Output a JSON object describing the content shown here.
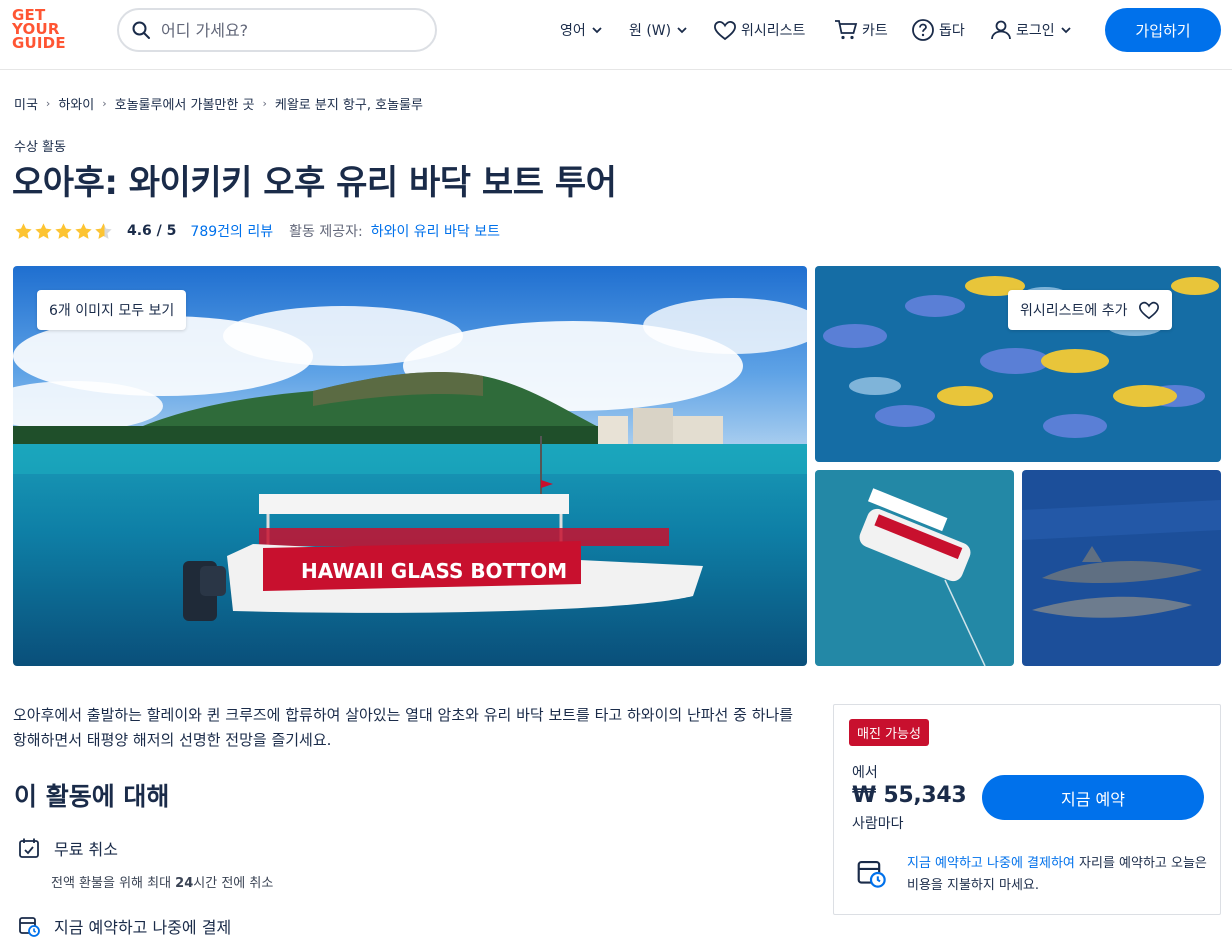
{
  "header": {
    "logo_lines": [
      "GET",
      "YOUR",
      "GUIDE"
    ],
    "search_placeholder": "어디 가세요?",
    "language_label": "영어",
    "currency_label": "원 (W)",
    "wishlist_label": "위시리스트",
    "cart_label": "카트",
    "help_label": "돕다",
    "login_label": "로그인",
    "signup_label": "가입하기",
    "brand_color": "#ff5533",
    "accent_color": "#0071eb"
  },
  "breadcrumb": [
    "미국",
    "하와이",
    "호놀룰루에서 가볼만한 곳",
    "케왈로 분지 항구, 호놀룰루"
  ],
  "activity": {
    "category": "수상 활동",
    "title": "오아후: 와이키키 오후 유리 바닥 보트 투어",
    "rating_value": "4.6 / 5",
    "rating_stars": 4.6,
    "review_count": "789",
    "review_suffix": "건의 리뷰",
    "provider_label": "활동 제공자:",
    "provider_name": "하와이 유리 바닥 보트"
  },
  "gallery": {
    "view_all_label": "6개 이미지 모두 보기",
    "add_wishlist_label": "위시리스트에 추가",
    "boat_sign_text": "HAWAII GLASS BOTTOM"
  },
  "description": "오아후에서 출발하는 할레이와 퀸 크루즈에 합류하여 살아있는 열대 암초와 유리 바닥 보트를 타고 하와이의 난파선 중 하나를 항해하면서 태평양 해저의 선명한 전망을 즐기세요.",
  "about": {
    "heading": "이 활동에 대해",
    "free_cancel_title": "무료 취소",
    "free_cancel_sub_prefix": "전액 환불을 위해 최대 ",
    "free_cancel_sub_bold": "24",
    "free_cancel_sub_suffix": "시간 전에 취소",
    "reserve_title": "지금 예약하고 나중에 결제"
  },
  "booking": {
    "badge": "매진 가능성",
    "badge_color": "#c8102e",
    "from_label": "에서",
    "price": "₩ 55,343",
    "per_label": "사람마다",
    "book_button": "지금 예약",
    "note_highlight": "지금 예약하고 나중에 결제하여",
    "note_rest": " 자리를 예약하고 오늘은 비용을 지불하지 마세요."
  }
}
